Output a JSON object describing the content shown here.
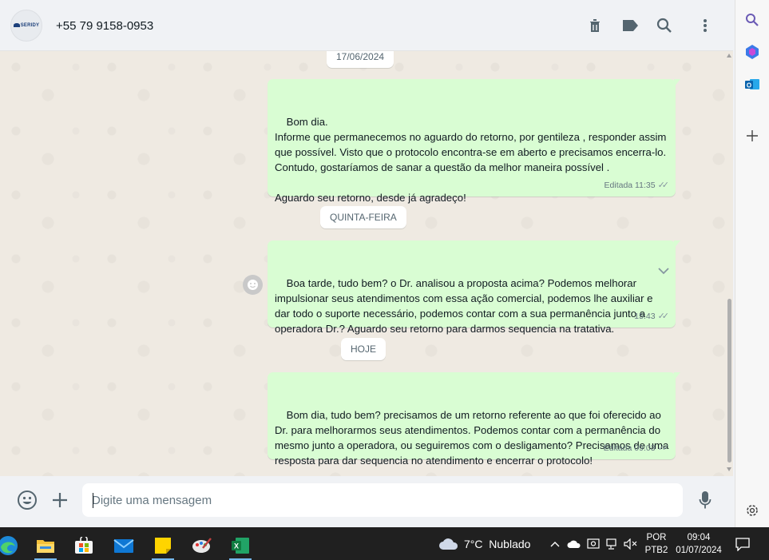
{
  "header": {
    "contact_name": "+55 79 9158-0953",
    "avatar_text": "SERIDY"
  },
  "chat": {
    "date_chips": [
      "17/06/2024",
      "QUINTA-FEIRA",
      "HOJE"
    ],
    "messages": [
      {
        "text": "Bom dia.\nInforme que permanecemos no aguardo do retorno, por gentileza , responder assim que possível. Visto que o protocolo encontra-se em aberto e precisamos encerra-lo. Contudo, gostaríamos de sanar a questão da melhor maneira possível .\n\nAguardo seu retorno, desde já agradeço!",
        "meta": "Editada 11:35"
      },
      {
        "text": "Boa tarde, tudo bem? o Dr. analisou a proposta acima? Podemos melhorar impulsionar seus atendimentos com essa ação comercial, podemos lhe auxiliar e dar todo o suporte necessário, podemos contar com a sua permanência junto a operadora Dr.? Aguardo seu retorno para darmos sequencia na tratativa.",
        "meta": "15:43"
      },
      {
        "text": "Bom dia, tudo bem? precisamos de um retorno referente ao que foi oferecido ao Dr. para melhorarmos seus atendimentos. Podemos contar com a permanência do mesmo junto a operadora, ou seguiremos com o desligamento? Precisamos de uma resposta para dar sequencia no atendimento e encerrar o protocolo!",
        "meta": "Editada 09:03"
      }
    ]
  },
  "compose": {
    "placeholder": "Digite uma mensagem"
  },
  "taskbar": {
    "temperature": "7°C",
    "weather": "Nublado",
    "language": "POR",
    "keyboard": "PTB2",
    "time": "09:04",
    "date": "01/07/2024"
  },
  "colors": {
    "outgoing_bubble": "#d9fdd3",
    "chat_background": "#efeae2",
    "header_background": "#f0f2f5",
    "taskbar_background": "#202020"
  },
  "icons": {
    "header": [
      "trash-icon",
      "label-icon",
      "search-icon",
      "more-vert-icon"
    ],
    "compose": [
      "emoji-icon",
      "attach-plus-icon",
      "mic-icon"
    ],
    "side": [
      "search-icon",
      "copilot-icon",
      "outlook-icon",
      "add-icon",
      "settings-icon"
    ]
  }
}
